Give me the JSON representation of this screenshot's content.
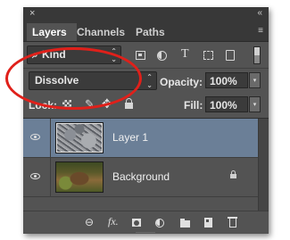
{
  "panel": {
    "close_glyph": "×",
    "collapse_glyph": "«",
    "menu_glyph": "≡"
  },
  "tabs": [
    {
      "label": "Layers",
      "active": true
    },
    {
      "label": "Channels",
      "active": false
    },
    {
      "label": "Paths",
      "active": false
    }
  ],
  "filter": {
    "search_glyph": "⌕",
    "kind_label": "Kind",
    "updown_glyph": "⌃\n⌄",
    "icons": [
      "pixel-filter-icon",
      "adjustment-filter-icon",
      "type-filter-icon",
      "shape-filter-icon",
      "smart-object-filter-icon"
    ],
    "type_glyph": "T"
  },
  "blend": {
    "mode": "Dissolve",
    "updown_glyph": "⌃\n⌄",
    "opacity_label": "Opacity:",
    "opacity_value": "100%",
    "drop_glyph": "▾"
  },
  "lock": {
    "label": "Lock:",
    "brush_glyph": "✎",
    "move_glyph": "✥",
    "fill_label": "Fill:",
    "fill_value": "100%",
    "drop_glyph": "▾"
  },
  "layers": [
    {
      "name": "Layer 1",
      "visible": true,
      "selected": true
    },
    {
      "name": "Background",
      "visible": true,
      "selected": false,
      "locked": true
    }
  ],
  "bottom_bar": {
    "link_glyph": "⊖",
    "fx_label": "fx.",
    "icons": [
      "link-layers-icon",
      "fx-icon",
      "layer-mask-icon",
      "adjustment-layer-icon",
      "group-folder-icon",
      "new-layer-icon",
      "trash-icon"
    ]
  },
  "annotation": {
    "color": "#e0201a"
  },
  "colors": {
    "panel": "#535353",
    "selection": "#6b7f97",
    "tabbar": "#383838"
  }
}
